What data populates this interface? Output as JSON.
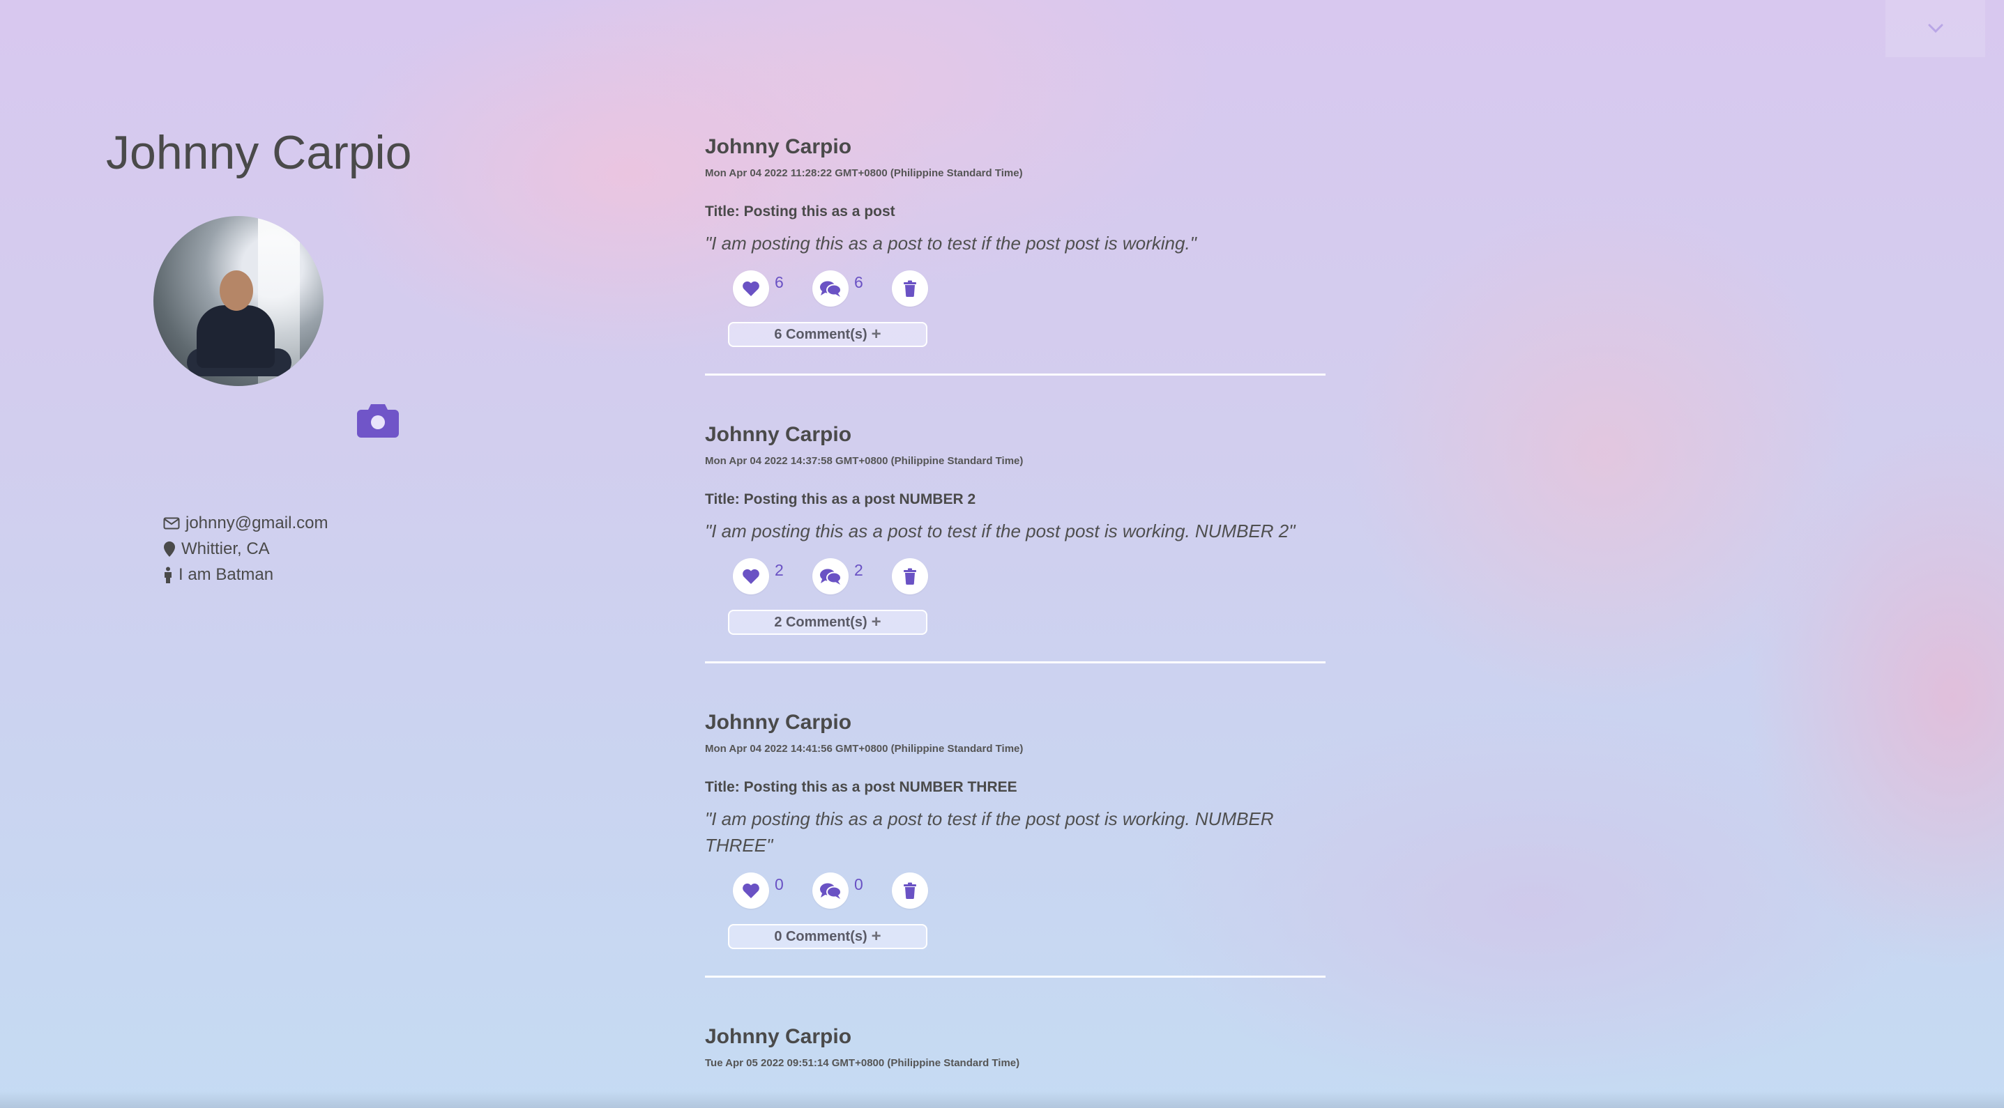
{
  "header": {
    "dropdown_icon": "chevron-down-icon"
  },
  "profile": {
    "name": "Johnny Carpio",
    "email": "johnny@gmail.com",
    "location": "Whittier, CA",
    "bio": "I am Batman",
    "avatar_alt": "Profile photo",
    "camera_icon": "camera-icon"
  },
  "theme": {
    "accent": "#6a52c4",
    "text": "#4a4a4a"
  },
  "posts": [
    {
      "author": "Johnny Carpio",
      "date": "Mon Apr 04 2022 11:28:22 GMT+0800 (Philippine Standard Time)",
      "title": "Title: Posting this as a post",
      "body": "\"I am posting this as a post to test if the post post is working.\"",
      "likes": "6",
      "comments": "6",
      "comments_button": "6 Comment(s)"
    },
    {
      "author": "Johnny Carpio",
      "date": "Mon Apr 04 2022 14:37:58 GMT+0800 (Philippine Standard Time)",
      "title": "Title: Posting this as a post NUMBER 2",
      "body": "\"I am posting this as a post to test if the post post is working. NUMBER 2\"",
      "likes": "2",
      "comments": "2",
      "comments_button": "2 Comment(s)"
    },
    {
      "author": "Johnny Carpio",
      "date": "Mon Apr 04 2022 14:41:56 GMT+0800 (Philippine Standard Time)",
      "title": "Title: Posting this as a post NUMBER THREE",
      "body": "\"I am posting this as a post to test if the post post is working. NUMBER THREE\"",
      "likes": "0",
      "comments": "0",
      "comments_button": "0 Comment(s)"
    },
    {
      "author": "Johnny Carpio",
      "date": "Tue Apr 05 2022 09:51:14 GMT+0800 (Philippine Standard Time)"
    }
  ]
}
